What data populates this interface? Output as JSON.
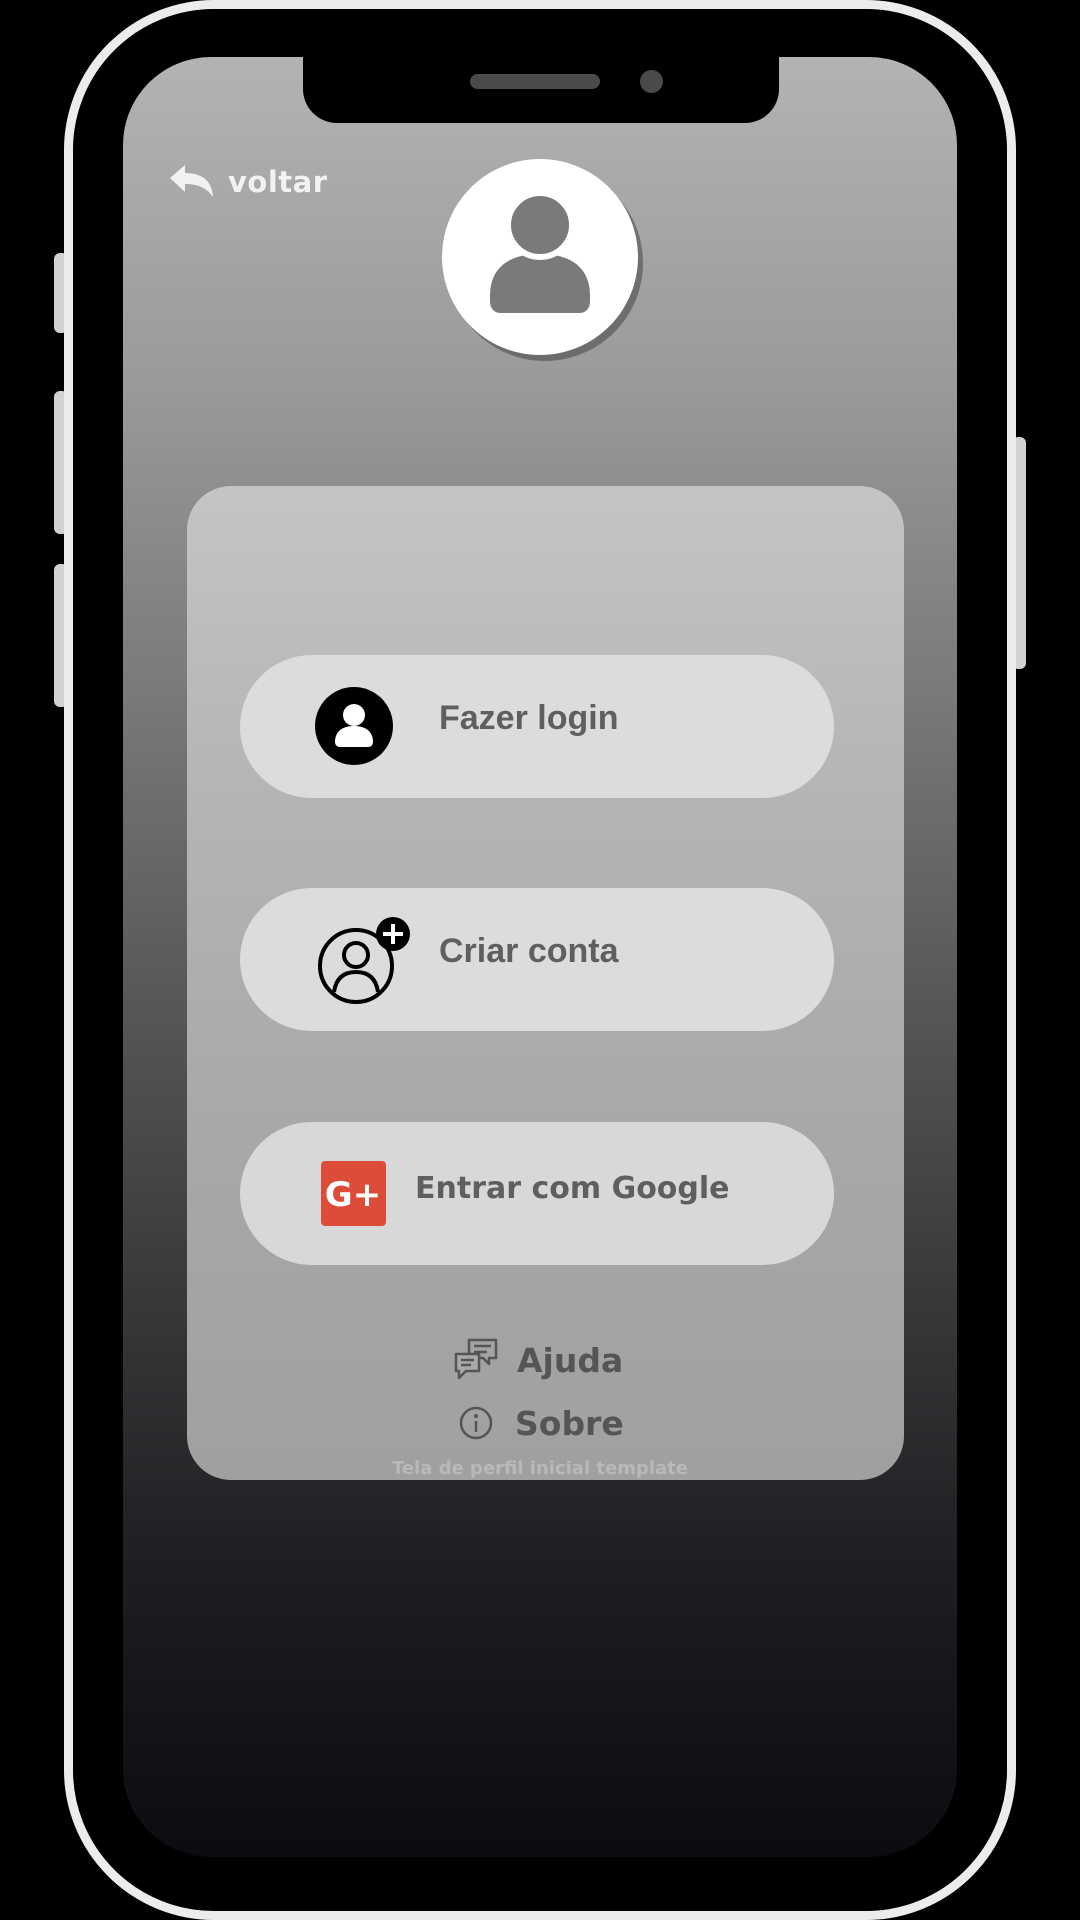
{
  "header": {
    "back_label": "voltar",
    "back_icon": "reply-arrow-icon",
    "avatar_icon": "user-avatar-icon"
  },
  "actions": {
    "login": {
      "label": "Fazer login",
      "icon": "user-circle-icon"
    },
    "create_account": {
      "label": "Criar conta",
      "icon": "user-add-icon"
    },
    "google": {
      "label": "Entrar com Google",
      "icon": "google-plus-icon",
      "icon_text": "G+"
    }
  },
  "links": {
    "help": {
      "label": "Ajuda",
      "icon": "chat-bubbles-icon"
    },
    "about": {
      "label": "Sobre",
      "icon": "info-icon"
    }
  },
  "caption": "Tela de perfil inicial template",
  "colors": {
    "background": "#000000",
    "phone_frame": "#ececec",
    "card": "#b5b5b5",
    "pill": "#dcdcdd",
    "label_text": "#5f5f5f",
    "google_red": "#dd4b39"
  }
}
